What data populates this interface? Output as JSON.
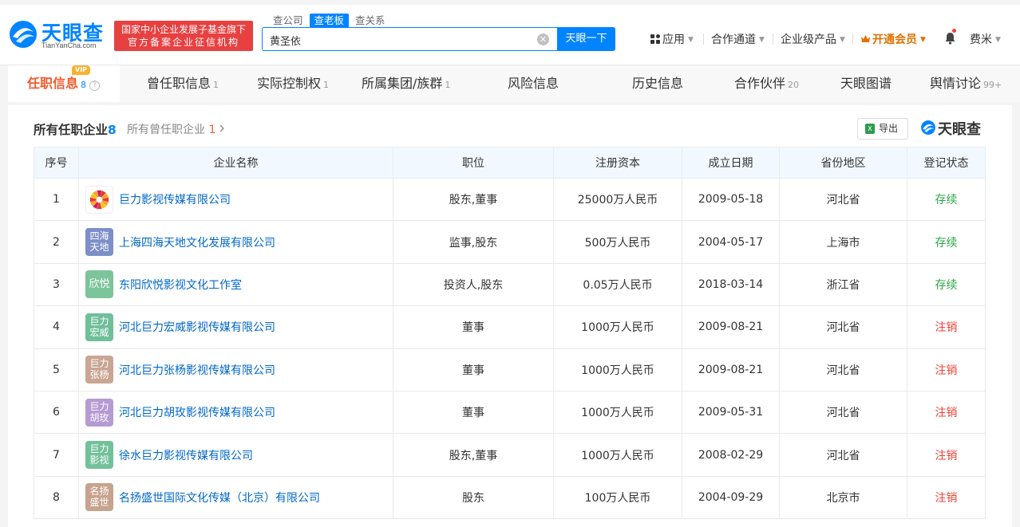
{
  "header": {
    "logo_name": "天眼查",
    "logo_domain": "TianYanCha.com",
    "gov_badge_line1": "国家中小企业发展子基金旗下",
    "gov_badge_line2": "官方备案企业征信机构",
    "search_tabs": [
      "查公司",
      "查老板",
      "查关系"
    ],
    "search_value": "黄圣依",
    "search_button": "天眼一下",
    "nav": {
      "apps": "应用",
      "partner": "合作通道",
      "enterprise": "企业级产品",
      "vip": "开通会员",
      "user": "费米"
    }
  },
  "tabs": [
    {
      "label": "任职信息",
      "count": "8"
    },
    {
      "label": "曾任职信息",
      "count": "1"
    },
    {
      "label": "实际控制权",
      "count": "1"
    },
    {
      "label": "所属集团/族群",
      "count": "1"
    },
    {
      "label": "风险信息",
      "count": ""
    },
    {
      "label": "历史信息",
      "count": ""
    },
    {
      "label": "合作伙伴",
      "count": "20"
    },
    {
      "label": "天眼图谱",
      "count": ""
    },
    {
      "label": "舆情讨论",
      "count": "99+"
    }
  ],
  "vip_badge": "VIP",
  "section": {
    "title": "所有任职企业",
    "count": "8",
    "past_label": "所有曾任职企业",
    "past_count": "1",
    "export_label": "导出",
    "brand": "天眼查"
  },
  "table": {
    "headers": [
      "序号",
      "企业名称",
      "职位",
      "注册资本",
      "成立日期",
      "省份地区",
      "登记状态"
    ],
    "rows": [
      {
        "idx": "1",
        "logo": "",
        "logo_color": "#ffffff",
        "name": "巨力影视传媒有限公司",
        "position": "股东,董事",
        "capital": "25000万人民币",
        "date": "2009-05-18",
        "region": "河北省",
        "status": "存续"
      },
      {
        "idx": "2",
        "logo": "四海天地",
        "logo_color": "#7d8fc8",
        "name": "上海四海天地文化发展有限公司",
        "position": "监事,股东",
        "capital": "500万人民币",
        "date": "2004-05-17",
        "region": "上海市",
        "status": "存续"
      },
      {
        "idx": "3",
        "logo": "欣悦",
        "logo_color": "#7cc49a",
        "name": "东阳欣悦影视文化工作室",
        "position": "投资人,股东",
        "capital": "0.05万人民币",
        "date": "2018-03-14",
        "region": "浙江省",
        "status": "存续"
      },
      {
        "idx": "4",
        "logo": "巨力宏威",
        "logo_color": "#6fbf99",
        "name": "河北巨力宏威影视传媒有限公司",
        "position": "董事",
        "capital": "1000万人民币",
        "date": "2009-08-21",
        "region": "河北省",
        "status": "注销"
      },
      {
        "idx": "5",
        "logo": "巨力张杨",
        "logo_color": "#c9a593",
        "name": "河北巨力张杨影视传媒有限公司",
        "position": "董事",
        "capital": "1000万人民币",
        "date": "2009-08-21",
        "region": "河北省",
        "status": "注销"
      },
      {
        "idx": "6",
        "logo": "巨力胡玫",
        "logo_color": "#b69ad2",
        "name": "河北巨力胡玫影视传媒有限公司",
        "position": "董事",
        "capital": "1000万人民币",
        "date": "2009-05-31",
        "region": "河北省",
        "status": "注销"
      },
      {
        "idx": "7",
        "logo": "巨力影视",
        "logo_color": "#72c19a",
        "name": "徐水巨力影视传媒有限公司",
        "position": "股东,董事",
        "capital": "1000万人民币",
        "date": "2008-02-29",
        "region": "河北省",
        "status": "注销"
      },
      {
        "idx": "8",
        "logo": "名扬盛世",
        "logo_color": "#c7a28d",
        "name": "名扬盛世国际文化传媒（北京）有限公司",
        "position": "股东",
        "capital": "100万人民币",
        "date": "2004-09-29",
        "region": "北京市",
        "status": "注销"
      }
    ]
  },
  "colors": {
    "brand_blue": "#0084ff",
    "accent_orange": "#f15a2c",
    "status_ok": "#28a745",
    "status_bad": "#f04134"
  }
}
